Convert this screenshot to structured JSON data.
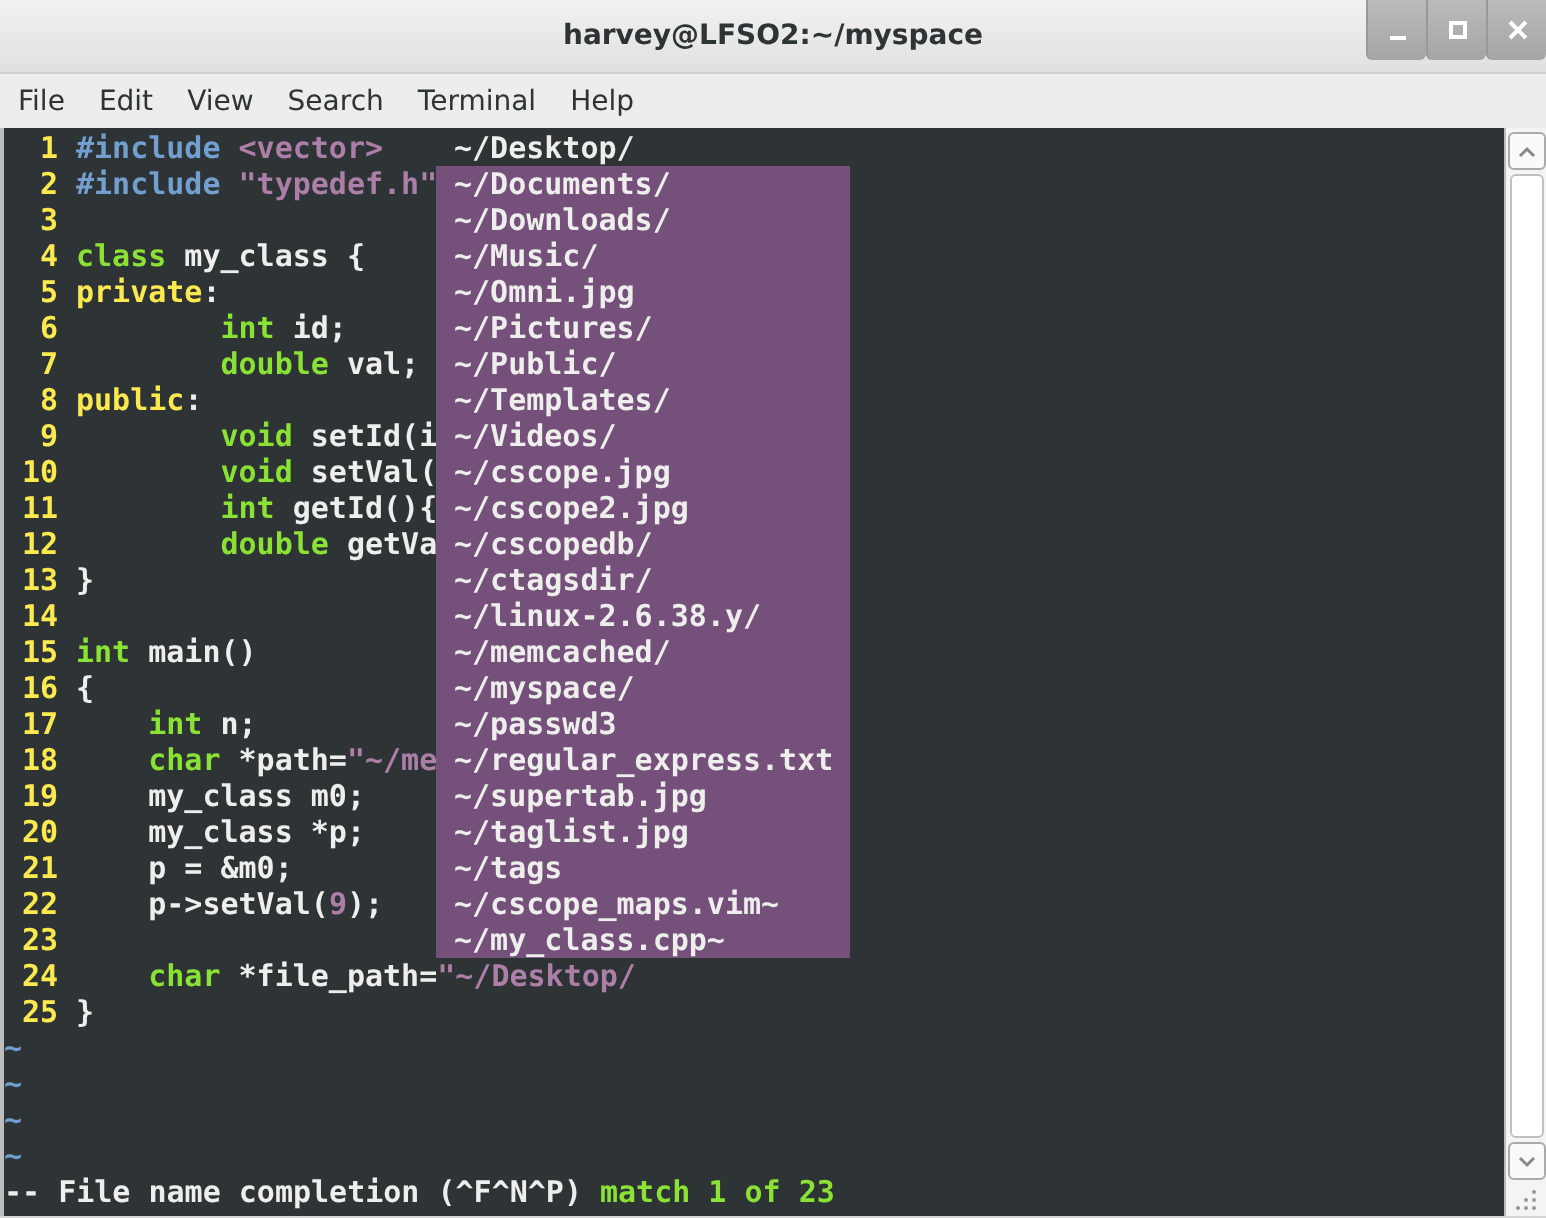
{
  "window": {
    "title": "harvey@LFSO2:~/myspace"
  },
  "menu": [
    "File",
    "Edit",
    "View",
    "Search",
    "Terminal",
    "Help"
  ],
  "editor": {
    "lines": [
      {
        "number": "1",
        "segments": [
          {
            "kind": "pre",
            "text": "#include"
          },
          {
            "kind": "str",
            "text": " <vector>"
          }
        ]
      },
      {
        "number": "2",
        "segments": [
          {
            "kind": "pre",
            "text": "#include"
          },
          {
            "kind": "str",
            "text": " \"typedef.h\""
          }
        ]
      },
      {
        "number": "3"
      },
      {
        "number": "4",
        "segments": [
          {
            "kind": "type",
            "text": "class"
          },
          {
            "kind": "plain",
            "text": " my_class {"
          }
        ]
      },
      {
        "number": "5",
        "segments": [
          {
            "kind": "label",
            "text": "private"
          },
          {
            "kind": "plain",
            "text": ":"
          }
        ]
      },
      {
        "number": "6",
        "segments": [
          {
            "kind": "type",
            "text": "        int"
          },
          {
            "kind": "plain",
            "text": " id;"
          }
        ]
      },
      {
        "number": "7",
        "segments": [
          {
            "kind": "type",
            "text": "        double"
          },
          {
            "kind": "plain",
            "text": " val;"
          }
        ]
      },
      {
        "number": "8",
        "segments": [
          {
            "kind": "label",
            "text": "public"
          },
          {
            "kind": "plain",
            "text": ":"
          }
        ]
      },
      {
        "number": "9",
        "segments": [
          {
            "kind": "type",
            "text": "        void"
          },
          {
            "kind": "plain",
            "text": " setId(i"
          }
        ]
      },
      {
        "number": "10",
        "segments": [
          {
            "kind": "type",
            "text": "        void"
          },
          {
            "kind": "plain",
            "text": " setVal("
          }
        ]
      },
      {
        "number": "11",
        "segments": [
          {
            "kind": "type",
            "text": "        int"
          },
          {
            "kind": "plain",
            "text": " getId(){"
          }
        ]
      },
      {
        "number": "12",
        "segments": [
          {
            "kind": "type",
            "text": "        double"
          },
          {
            "kind": "plain",
            "text": " getVa"
          }
        ]
      },
      {
        "number": "13",
        "segments": [
          {
            "kind": "plain",
            "text": "}"
          }
        ]
      },
      {
        "number": "14"
      },
      {
        "number": "15",
        "segments": [
          {
            "kind": "type",
            "text": "int"
          },
          {
            "kind": "plain",
            "text": " main()"
          }
        ]
      },
      {
        "number": "16",
        "segments": [
          {
            "kind": "plain",
            "text": "{"
          }
        ]
      },
      {
        "number": "17",
        "segments": [
          {
            "kind": "type",
            "text": "    int"
          },
          {
            "kind": "plain",
            "text": " n;"
          }
        ]
      },
      {
        "number": "18",
        "segments": [
          {
            "kind": "type",
            "text": "    char"
          },
          {
            "kind": "plain",
            "text": " *path="
          },
          {
            "kind": "str",
            "text": "\"~/me"
          }
        ]
      },
      {
        "number": "19",
        "segments": [
          {
            "kind": "plain",
            "text": "    my_class m0;"
          }
        ]
      },
      {
        "number": "20",
        "segments": [
          {
            "kind": "plain",
            "text": "    my_class *p;"
          }
        ]
      },
      {
        "number": "21",
        "segments": [
          {
            "kind": "plain",
            "text": "    p = &m0;"
          }
        ]
      },
      {
        "number": "22",
        "segments": [
          {
            "kind": "plain",
            "text": "    p->setVal("
          },
          {
            "kind": "str",
            "text": "9"
          },
          {
            "kind": "plain",
            "text": ");"
          }
        ]
      },
      {
        "number": "23"
      },
      {
        "number": "24",
        "segments": [
          {
            "kind": "type",
            "text": "    char"
          },
          {
            "kind": "plain",
            "text": " *file_path="
          },
          {
            "kind": "str",
            "text": "\"~/Desktop/"
          }
        ]
      },
      {
        "number": "25",
        "segments": [
          {
            "kind": "plain",
            "text": "}"
          }
        ]
      }
    ],
    "tildes": [
      "~",
      "~",
      "~",
      "~"
    ],
    "completion_menu": {
      "items": [
        {
          "text": "~/Desktop/",
          "selected": true
        },
        {
          "text": "~/Documents/",
          "selected": false
        },
        {
          "text": "~/Downloads/",
          "selected": false
        },
        {
          "text": "~/Music/",
          "selected": false
        },
        {
          "text": "~/Omni.jpg",
          "selected": false
        },
        {
          "text": "~/Pictures/",
          "selected": false
        },
        {
          "text": "~/Public/",
          "selected": false
        },
        {
          "text": "~/Templates/",
          "selected": false
        },
        {
          "text": "~/Videos/",
          "selected": false
        },
        {
          "text": "~/cscope.jpg",
          "selected": false
        },
        {
          "text": "~/cscope2.jpg",
          "selected": false
        },
        {
          "text": "~/cscopedb/",
          "selected": false
        },
        {
          "text": "~/ctagsdir/",
          "selected": false
        },
        {
          "text": "~/linux-2.6.38.y/",
          "selected": false
        },
        {
          "text": "~/memcached/",
          "selected": false
        },
        {
          "text": "~/myspace/",
          "selected": false
        },
        {
          "text": "~/passwd3",
          "selected": false
        },
        {
          "text": "~/regular_express.txt",
          "selected": false
        },
        {
          "text": "~/supertab.jpg",
          "selected": false
        },
        {
          "text": "~/taglist.jpg",
          "selected": false
        },
        {
          "text": "~/tags",
          "selected": false
        },
        {
          "text": "~/cscope_maps.vim~",
          "selected": false
        },
        {
          "text": "~/my_class.cpp~",
          "selected": false
        }
      ]
    },
    "status": {
      "mode": "-- File name completion (^F^N^P)",
      "match": "match 1 of 23"
    }
  }
}
